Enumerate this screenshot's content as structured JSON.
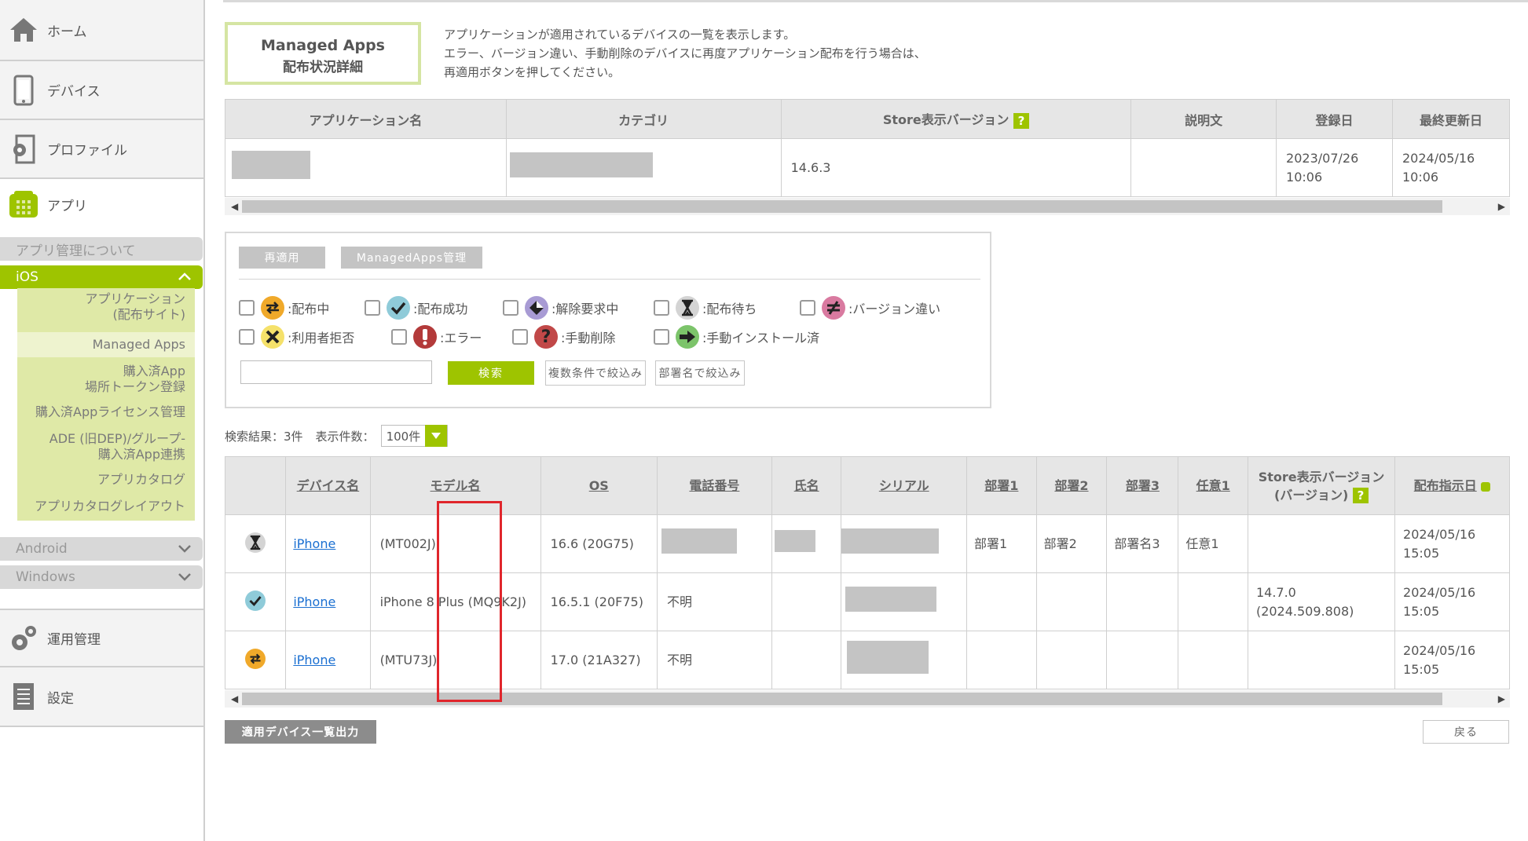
{
  "sidebar": {
    "nav": [
      {
        "label": "ホーム",
        "icon": "home-icon"
      },
      {
        "label": "デバイス",
        "icon": "smartphone-icon"
      },
      {
        "label": "プロファイル",
        "icon": "profile-gear-icon"
      },
      {
        "label": "アプリ",
        "icon": "app-grid-icon"
      },
      {
        "label": "運用管理",
        "icon": "gears-icon"
      },
      {
        "label": "設定",
        "icon": "document-icon"
      }
    ],
    "app_about": "アプリ管理について",
    "ios_label": "iOS",
    "android_label": "Android",
    "windows_label": "Windows",
    "ios_items": [
      {
        "line1": "アプリケーション",
        "line2": "(配布サイト)"
      },
      {
        "line1": "Managed Apps",
        "line2": ""
      },
      {
        "line1": "購入済App",
        "line2": "場所トークン登録"
      },
      {
        "line1": "購入済Appライセンス管理",
        "line2": ""
      },
      {
        "line1": "ADE (旧DEP)/グループ-",
        "line2": "購入済App連携"
      },
      {
        "line1": "アプリカタログ",
        "line2": ""
      },
      {
        "line1": "アプリカタログレイアウト",
        "line2": ""
      }
    ]
  },
  "header": {
    "title_line1": "Managed Apps",
    "title_line2": "配布状況詳細",
    "desc_line1": "アプリケーションが適用されているデバイスの一覧を表示します。",
    "desc_line2": "エラー、バージョン違い、手動削除のデバイスに再度アプリケーション配布を行う場合は、",
    "desc_line3": "再適用ボタンを押してください。"
  },
  "app_table": {
    "headers": [
      "アプリケーション名",
      "カテゴリ",
      "Store表示バージョン",
      "説明文",
      "登録日",
      "最終更新日"
    ],
    "help_mark": "?",
    "row": {
      "version": "14.6.3",
      "registered_date": "2023/07/26",
      "registered_time": "10:06",
      "updated_date": "2024/05/16",
      "updated_time": "10:06"
    }
  },
  "filter": {
    "reapply_label": "再適用",
    "managed_apps_label": "ManagedApps管理",
    "statuses_row1": [
      {
        "label": ":配布中",
        "icon": "distributing-icon"
      },
      {
        "label": ":配布成功",
        "icon": "success-check-icon"
      },
      {
        "label": ":解除要求中",
        "icon": "release-request-icon"
      },
      {
        "label": ":配布待ち",
        "icon": "hourglass-icon"
      },
      {
        "label": ":バージョン違い",
        "icon": "version-mismatch-icon"
      }
    ],
    "statuses_row2": [
      {
        "label": ":利用者拒否",
        "icon": "user-rejected-icon"
      },
      {
        "label": ":エラー",
        "icon": "error-icon"
      },
      {
        "label": ":手動削除",
        "icon": "manual-delete-icon"
      },
      {
        "label": ":手動インストール済",
        "icon": "manual-install-icon"
      }
    ],
    "search_value": "",
    "search_label": "検索",
    "multi_filter_label": "複数条件で絞込み",
    "dept_filter_label": "部署名で絞込み"
  },
  "results": {
    "summary": "検索結果：3件",
    "per_page_label": "表示件数：",
    "per_page_value": "100件"
  },
  "device_table": {
    "headers": [
      "デバイス名",
      "モデル名",
      "OS",
      "電話番号",
      "氏名",
      "シリアル",
      "部署1",
      "部署2",
      "部署3",
      "任意1"
    ],
    "store_header_line1": "Store表示バージョン",
    "store_header_line2": "(バージョン)",
    "dispatch_header": "配布指示日",
    "rows": [
      {
        "status_icon": "hourglass-icon",
        "device": "iPhone",
        "model": "(MT002J)",
        "os": "16.6 (20G75)",
        "phone": "",
        "dept1": "部署1",
        "dept2": "部署2",
        "dept3": "部署名3",
        "opt1": "任意1",
        "store_v1": "",
        "store_v2": "",
        "date": "2024/05/16",
        "time": "15:05"
      },
      {
        "status_icon": "success-check-icon",
        "device": "iPhone",
        "model": "iPhone 8 Plus (MQ9K2J)",
        "os": "16.5.1 (20F75)",
        "phone": "不明",
        "dept1": "",
        "dept2": "",
        "dept3": "",
        "opt1": "",
        "store_v1": "14.7.0",
        "store_v2": "(2024.509.808)",
        "date": "2024/05/16",
        "time": "15:05"
      },
      {
        "status_icon": "distributing-icon",
        "device": "iPhone",
        "model": "(MTU73J)",
        "os": "17.0 (21A327)",
        "phone": "不明",
        "dept1": "",
        "dept2": "",
        "dept3": "",
        "opt1": "",
        "store_v1": "",
        "store_v2": "",
        "date": "2024/05/16",
        "time": "15:05"
      }
    ]
  },
  "footer": {
    "export_label": "適用デバイス一覧出力",
    "back_label": "戻る"
  },
  "colors": {
    "accent_green": "#9ec400",
    "submenu_bg": "#dfe9a7",
    "highlight_red": "#e0262c",
    "link_blue": "#1a6fd1"
  }
}
